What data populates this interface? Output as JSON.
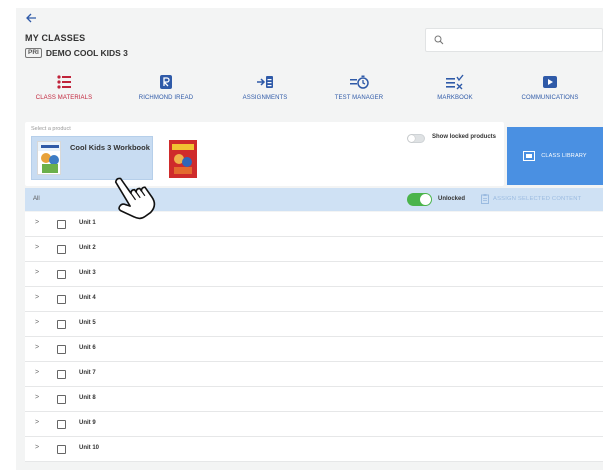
{
  "header": {
    "title": "MY CLASSES",
    "class_badge": "PRI",
    "class_name": "DEMO COOL KIDS 3"
  },
  "nav": [
    {
      "label": "CLASS MATERIALS",
      "icon": "list-icon",
      "active": true
    },
    {
      "label": "RICHMOND IREAD",
      "icon": "book-r-icon"
    },
    {
      "label": "ASSIGNMENTS",
      "icon": "arrow-list-icon"
    },
    {
      "label": "TEST MANAGER",
      "icon": "timer-icon"
    },
    {
      "label": "MARKBOOK",
      "icon": "grade-icon"
    },
    {
      "label": "COMMUNICATIONS",
      "icon": "play-box-icon"
    }
  ],
  "product": {
    "select_label": "Select a product",
    "selected_name": "Cool Kids 3 Workbook",
    "show_locked_label": "Show locked products",
    "class_library_label": "CLASS LIBRARY"
  },
  "list": {
    "all_label": "All",
    "unlocked_label": "Unlocked",
    "assign_label": "ASSIGN SELECTED CONTENT",
    "units": [
      "Unit 1",
      "Unit 2",
      "Unit 3",
      "Unit 4",
      "Unit 5",
      "Unit 6",
      "Unit 7",
      "Unit 8",
      "Unit 9",
      "Unit 10"
    ]
  },
  "colors": {
    "accent": "#4a90e2",
    "active_nav": "#c0233a",
    "nav": "#2f5aa8",
    "toggle_on": "#4bb44b"
  }
}
